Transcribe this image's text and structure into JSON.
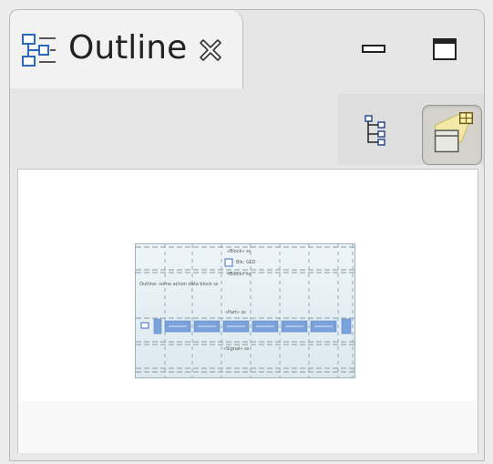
{
  "view": {
    "title": "Outline",
    "tab_icon": "outline-view-icon",
    "close_icon": "close-icon",
    "minimize_icon": "minimize-icon",
    "maximize_icon": "maximize-icon"
  },
  "toolbar": {
    "tree_button_icon": "tree-view-icon",
    "overview_button_icon": "overview-icon",
    "overview_active": true
  },
  "thumbnail": {
    "lines": [
      "«Block» ss",
      "Blk: GLD",
      "«Block» ss",
      "Outline: some action data block ss",
      "«Part» ss",
      "«Signal» ss"
    ]
  },
  "colors": {
    "accent": "#1a5fb4",
    "thumb_bar": "#7aa2dc",
    "active_toggle": "#d3d3cc"
  }
}
